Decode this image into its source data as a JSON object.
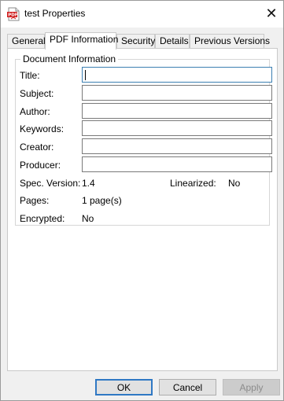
{
  "window": {
    "title": "test Properties",
    "close_glyph": "✕",
    "icon": "pdf-document-icon"
  },
  "tabs": [
    {
      "label": "General"
    },
    {
      "label": "PDF Information"
    },
    {
      "label": "Security"
    },
    {
      "label": "Details"
    },
    {
      "label": "Previous Versions"
    }
  ],
  "active_tab": "PDF Information",
  "document_info": {
    "group_label": "Document Information",
    "fields": [
      {
        "label": "Title:",
        "value": ""
      },
      {
        "label": "Subject:",
        "value": ""
      },
      {
        "label": "Author:",
        "value": ""
      },
      {
        "label": "Keywords:",
        "value": ""
      },
      {
        "label": "Creator:",
        "value": ""
      },
      {
        "label": "Producer:",
        "value": ""
      }
    ],
    "spec_version_label": "Spec. Version:",
    "spec_version": "1.4",
    "linearized_label": "Linearized:",
    "linearized": "No",
    "pages_label": "Pages:",
    "pages": "1 page(s)",
    "encrypted_label": "Encrypted:",
    "encrypted": "No"
  },
  "buttons": {
    "ok": "OK",
    "cancel": "Cancel",
    "apply": "Apply"
  },
  "colors": {
    "default_button_border": "#2f78c4",
    "focus_border": "#3c7fb1"
  }
}
